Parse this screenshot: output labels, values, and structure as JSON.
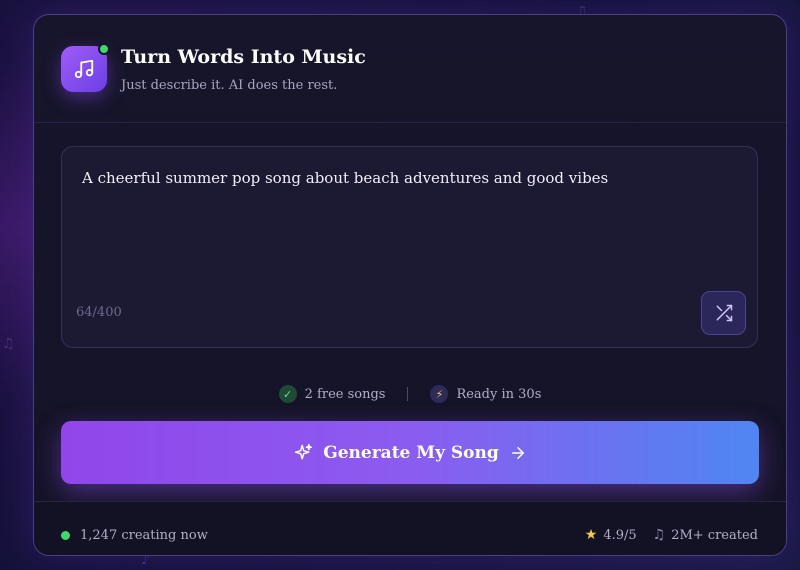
{
  "header": {
    "title": "Turn Words Into Music",
    "subtitle": "Just describe it. AI does the rest.",
    "logo_icon": "music-note-icon",
    "status_color": "#3fd86a"
  },
  "prompt": {
    "value": "A cheerful summer pop song about beach adventures and good vibes",
    "char_count": "64/400",
    "shuffle_icon": "shuffle-icon"
  },
  "features": [
    {
      "icon": "check-icon",
      "label": "2 free songs"
    },
    {
      "icon": "bolt-icon",
      "label": "Ready in 30s"
    }
  ],
  "generate_button": {
    "label": "Generate My Song",
    "icon_left": "sparkle-icon",
    "icon_right": "arrow-right-icon"
  },
  "footer": {
    "live_count": "1,247 creating now",
    "rating": "4.9/5",
    "created": "2M+ created"
  },
  "colors": {
    "accent_start": "#9146ea",
    "accent_end": "#4f86f2",
    "live": "#3fd86a",
    "star": "#f6c945"
  }
}
